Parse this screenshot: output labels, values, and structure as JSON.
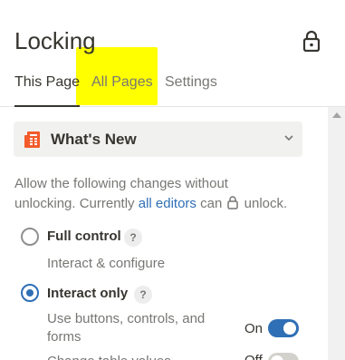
{
  "header": {
    "title": "Locking",
    "lock_icon": "padlock-icon"
  },
  "tabs": [
    {
      "label": "This Page",
      "active": true
    },
    {
      "label": "All Pages",
      "active": false
    },
    {
      "label": "Settings",
      "active": false
    }
  ],
  "page_select": {
    "icon": "newspaper-icon",
    "icon_color": "#f35b2a",
    "label": "What's New"
  },
  "description": {
    "line1": "Allow the following changes without",
    "line2_prefix": "unlocking. Currently ",
    "link": "all editors",
    "line2_mid": " can ",
    "line2_suffix": " unlock."
  },
  "options": [
    {
      "label": "Full control",
      "help": "?",
      "sub": "Interact & configure",
      "selected": false
    },
    {
      "label": "Interact only",
      "help": "?",
      "selected": true
    }
  ],
  "permissions": [
    {
      "label": "Use buttons, controls, and forms",
      "state_label": "On",
      "on": true
    },
    {
      "label": "Change table values",
      "state_label": "Off",
      "on": false
    }
  ],
  "colors": {
    "accent": "#2f6fb5",
    "highlight": "#ffff00"
  }
}
